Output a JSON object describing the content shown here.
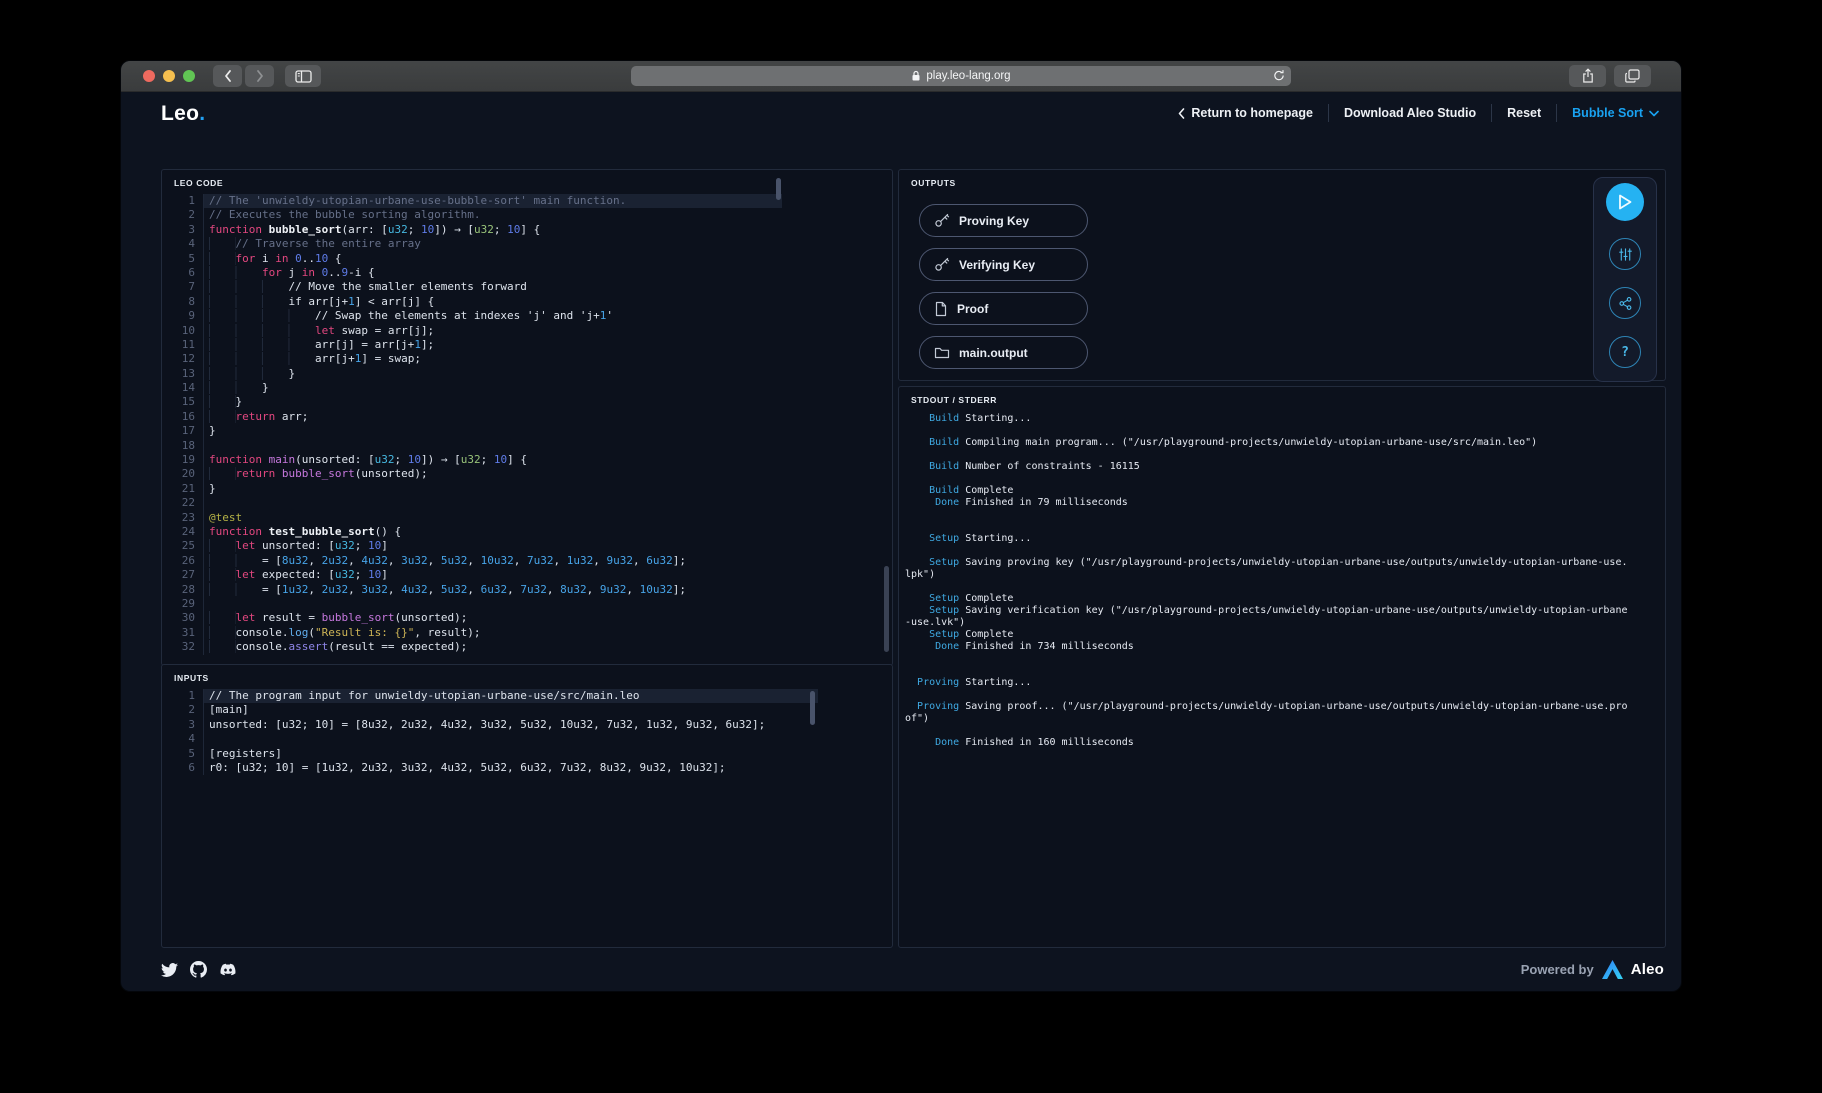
{
  "browser": {
    "url": "play.leo-lang.org",
    "traffic_lights": [
      "close",
      "minimize",
      "zoom"
    ]
  },
  "header": {
    "logo": "Leo",
    "logo_dot": ".",
    "nav": [
      {
        "label": "Return to homepage"
      },
      {
        "label": "Download Aleo Studio"
      },
      {
        "label": "Reset"
      },
      {
        "label": "Bubble Sort"
      }
    ]
  },
  "colors": {
    "accent": "#19a2f1",
    "run_button": "#25b2f2",
    "status_label": "#3fa9e2",
    "keyword": "#e2477f"
  },
  "editor": {
    "label": "LEO CODE",
    "lines": [
      {
        "a": true,
        "s": [
          [
            "c",
            "// The 'unwieldy-utopian-urbane-use-bubble-sort' main function."
          ]
        ]
      },
      {
        "s": [
          [
            "c",
            "// Executes the bubble sorting algorithm."
          ]
        ]
      },
      {
        "s": [
          [
            "k",
            "function "
          ],
          [
            "f",
            "bubble_sort"
          ],
          [
            "p",
            "(arr: ["
          ],
          [
            "t",
            "u32"
          ],
          [
            "p",
            "; "
          ],
          [
            "n",
            "10"
          ],
          [
            "p",
            "]) → ["
          ],
          [
            "g",
            "u32"
          ],
          [
            "p",
            "; "
          ],
          [
            "n",
            "10"
          ],
          [
            "p",
            "] {"
          ]
        ]
      },
      {
        "s": [
          [
            "i",
            "    "
          ],
          [
            "c",
            "// Traverse the entire array"
          ]
        ]
      },
      {
        "s": [
          [
            "i",
            "    "
          ],
          [
            "k",
            "for "
          ],
          [
            "p",
            "i "
          ],
          [
            "k",
            "in "
          ],
          [
            "n",
            "0"
          ],
          [
            "p",
            ".."
          ],
          [
            "n",
            "10"
          ],
          [
            "p",
            " {"
          ]
        ]
      },
      {
        "s": [
          [
            "i",
            "        "
          ],
          [
            "k",
            "for "
          ],
          [
            "p",
            "j "
          ],
          [
            "k",
            "in "
          ],
          [
            "n",
            "0"
          ],
          [
            "p",
            ".."
          ],
          [
            "n",
            "9"
          ],
          [
            "p",
            "-i {"
          ]
        ]
      },
      {
        "s": [
          [
            "i",
            "            "
          ],
          [
            "p",
            "// Move the smaller elements forward"
          ]
        ]
      },
      {
        "s": [
          [
            "i",
            "            "
          ],
          [
            "p",
            "if arr[j+"
          ],
          [
            "l",
            "1"
          ],
          [
            "p",
            "] < arr[j] {"
          ]
        ]
      },
      {
        "s": [
          [
            "i",
            "                "
          ],
          [
            "p",
            "// Swap the elements at indexes 'j' and 'j+"
          ],
          [
            "l",
            "1"
          ],
          [
            "p",
            "'"
          ]
        ]
      },
      {
        "s": [
          [
            "i",
            "                "
          ],
          [
            "k",
            "let "
          ],
          [
            "p",
            "swap = arr[j];"
          ]
        ]
      },
      {
        "s": [
          [
            "i",
            "                "
          ],
          [
            "p",
            "arr[j] = arr[j+"
          ],
          [
            "l",
            "1"
          ],
          [
            "p",
            "];"
          ]
        ]
      },
      {
        "s": [
          [
            "i",
            "                "
          ],
          [
            "p",
            "arr[j+"
          ],
          [
            "l",
            "1"
          ],
          [
            "p",
            "] = swap;"
          ]
        ]
      },
      {
        "s": [
          [
            "i",
            "            "
          ],
          [
            "p",
            "}"
          ]
        ]
      },
      {
        "s": [
          [
            "i",
            "        "
          ],
          [
            "p",
            "}"
          ]
        ]
      },
      {
        "s": [
          [
            "i",
            "    "
          ],
          [
            "p",
            "}"
          ]
        ]
      },
      {
        "s": [
          [
            "i",
            "    "
          ],
          [
            "k",
            "return "
          ],
          [
            "p",
            "arr;"
          ]
        ]
      },
      {
        "s": [
          [
            "p",
            "}"
          ]
        ]
      },
      {
        "s": []
      },
      {
        "s": [
          [
            "k",
            "function "
          ],
          [
            "m",
            "main"
          ],
          [
            "p",
            "(unsorted: ["
          ],
          [
            "t",
            "u32"
          ],
          [
            "p",
            "; "
          ],
          [
            "n",
            "10"
          ],
          [
            "p",
            "]) → ["
          ],
          [
            "g",
            "u32"
          ],
          [
            "p",
            "; "
          ],
          [
            "n",
            "10"
          ],
          [
            "p",
            "] {"
          ]
        ]
      },
      {
        "s": [
          [
            "i",
            "    "
          ],
          [
            "k",
            "return "
          ],
          [
            "m",
            "bubble_sort"
          ],
          [
            "p",
            "(unsorted);"
          ]
        ]
      },
      {
        "s": [
          [
            "p",
            "}"
          ]
        ]
      },
      {
        "s": []
      },
      {
        "s": [
          [
            "d",
            "@test"
          ]
        ]
      },
      {
        "s": [
          [
            "k",
            "function "
          ],
          [
            "f",
            "test_bubble_sort"
          ],
          [
            "p",
            "() {"
          ]
        ]
      },
      {
        "s": [
          [
            "i",
            "    "
          ],
          [
            "k",
            "let "
          ],
          [
            "p",
            "unsorted: ["
          ],
          [
            "t",
            "u32"
          ],
          [
            "p",
            "; "
          ],
          [
            "n",
            "10"
          ],
          [
            "p",
            "]"
          ]
        ]
      },
      {
        "s": [
          [
            "i",
            "        "
          ],
          [
            "p",
            "= ["
          ],
          [
            "l",
            "8u32"
          ],
          [
            "p",
            ", "
          ],
          [
            "l",
            "2u32"
          ],
          [
            "p",
            ", "
          ],
          [
            "l",
            "4u32"
          ],
          [
            "p",
            ", "
          ],
          [
            "l",
            "3u32"
          ],
          [
            "p",
            ", "
          ],
          [
            "l",
            "5u32"
          ],
          [
            "p",
            ", "
          ],
          [
            "l",
            "10u32"
          ],
          [
            "p",
            ", "
          ],
          [
            "l",
            "7u32"
          ],
          [
            "p",
            ", "
          ],
          [
            "l",
            "1u32"
          ],
          [
            "p",
            ", "
          ],
          [
            "l",
            "9u32"
          ],
          [
            "p",
            ", "
          ],
          [
            "l",
            "6u32"
          ],
          [
            "p",
            "];"
          ]
        ]
      },
      {
        "s": [
          [
            "i",
            "    "
          ],
          [
            "k",
            "let "
          ],
          [
            "p",
            "expected: ["
          ],
          [
            "t",
            "u32"
          ],
          [
            "p",
            "; "
          ],
          [
            "n",
            "10"
          ],
          [
            "p",
            "]"
          ]
        ]
      },
      {
        "s": [
          [
            "i",
            "        "
          ],
          [
            "p",
            "= ["
          ],
          [
            "l",
            "1u32"
          ],
          [
            "p",
            ", "
          ],
          [
            "l",
            "2u32"
          ],
          [
            "p",
            ", "
          ],
          [
            "l",
            "3u32"
          ],
          [
            "p",
            ", "
          ],
          [
            "l",
            "4u32"
          ],
          [
            "p",
            ", "
          ],
          [
            "l",
            "5u32"
          ],
          [
            "p",
            ", "
          ],
          [
            "l",
            "6u32"
          ],
          [
            "p",
            ", "
          ],
          [
            "l",
            "7u32"
          ],
          [
            "p",
            ", "
          ],
          [
            "l",
            "8u32"
          ],
          [
            "p",
            ", "
          ],
          [
            "l",
            "9u32"
          ],
          [
            "p",
            ", "
          ],
          [
            "l",
            "10u32"
          ],
          [
            "p",
            "];"
          ]
        ]
      },
      {
        "s": []
      },
      {
        "s": [
          [
            "i",
            "    "
          ],
          [
            "k",
            "let "
          ],
          [
            "p",
            "result = "
          ],
          [
            "m",
            "bubble_sort"
          ],
          [
            "p",
            "(unsorted);"
          ]
        ]
      },
      {
        "s": [
          [
            "i",
            "    "
          ],
          [
            "p",
            "console."
          ],
          [
            "b",
            "log"
          ],
          [
            "p",
            "("
          ],
          [
            "s",
            "\"Result is: {}\""
          ],
          [
            "p",
            ", result);"
          ]
        ]
      },
      {
        "s": [
          [
            "i",
            "    "
          ],
          [
            "p",
            "console."
          ],
          [
            "a",
            "assert"
          ],
          [
            "p",
            "(result == expected);"
          ]
        ]
      }
    ]
  },
  "inputs": {
    "label": "INPUTS",
    "lines": [
      {
        "a": true,
        "s": [
          [
            "p",
            "// The program input for unwieldy-utopian-urbane-use/src/main.leo"
          ]
        ]
      },
      {
        "s": [
          [
            "p",
            "[main]"
          ]
        ]
      },
      {
        "s": [
          [
            "p",
            "unsorted: [u32; 10] = [8u32, 2u32, 4u32, 3u32, 5u32, 10u32, 7u32, 1u32, 9u32, 6u32];"
          ]
        ]
      },
      {
        "s": []
      },
      {
        "s": [
          [
            "p",
            "[registers]"
          ]
        ]
      },
      {
        "s": [
          [
            "p",
            "r0: [u32; 10] = [1u32, 2u32, 3u32, 4u32, 5u32, 6u32, 7u32, 8u32, 9u32, 10u32];"
          ]
        ]
      }
    ]
  },
  "outputs": {
    "label": "OUTPUTS",
    "buttons": [
      {
        "label": "Proving Key",
        "icon": "key-icon"
      },
      {
        "label": "Verifying Key",
        "icon": "key-icon"
      },
      {
        "label": "Proof",
        "icon": "document-icon"
      },
      {
        "label": "main.output",
        "icon": "folder-icon"
      }
    ]
  },
  "actions": [
    {
      "name": "run",
      "icon": "play-icon"
    },
    {
      "name": "settings",
      "icon": "sliders-icon"
    },
    {
      "name": "share",
      "icon": "share-nodes-icon"
    },
    {
      "name": "help",
      "icon": "question-icon",
      "glyph": "?"
    }
  ],
  "stdout": {
    "label": "STDOUT / STDERR",
    "lines": [
      {
        "label": "Build",
        "text": "Starting..."
      },
      {},
      {
        "label": "Build",
        "text": "Compiling main program... (\"/usr/playground-projects/unwieldy-utopian-urbane-use/src/main.leo\")"
      },
      {},
      {
        "label": "Build",
        "text": "Number of constraints - 16115"
      },
      {},
      {
        "label": "Build",
        "text": "Complete"
      },
      {
        "label": "Done",
        "text": "Finished in 79 milliseconds"
      },
      {},
      {},
      {
        "label": "Setup",
        "text": "Starting..."
      },
      {},
      {
        "label": "Setup",
        "text": "Saving proving key (\"/usr/playground-projects/unwieldy-utopian-urbane-use/outputs/unwieldy-utopian-urbane-use.lpk\")"
      },
      {},
      {
        "label": "Setup",
        "text": "Complete"
      },
      {
        "label": "Setup",
        "text": "Saving verification key (\"/usr/playground-projects/unwieldy-utopian-urbane-use/outputs/unwieldy-utopian-urbane-use.lvk\")"
      },
      {
        "label": "Setup",
        "text": "Complete"
      },
      {
        "label": "Done",
        "text": "Finished in 734 milliseconds"
      },
      {},
      {},
      {
        "label": "Proving",
        "text": "Starting..."
      },
      {},
      {
        "label": "Proving",
        "text": "Saving proof... (\"/usr/playground-projects/unwieldy-utopian-urbane-use/outputs/unwieldy-utopian-urbane-use.proof\")"
      },
      {},
      {
        "label": "Done",
        "text": "Finished in 160 milliseconds"
      }
    ]
  },
  "footer": {
    "powered_by": "Powered by",
    "brand": "Aleo",
    "social": [
      "twitter",
      "github",
      "discord"
    ]
  }
}
